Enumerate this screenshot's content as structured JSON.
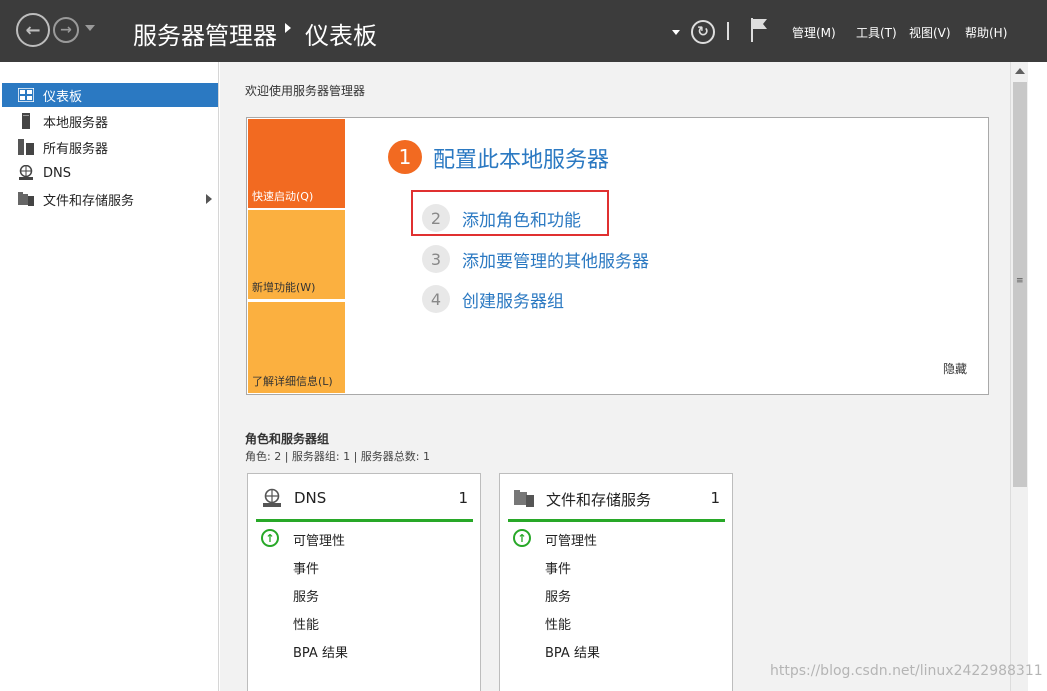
{
  "titlebar": {
    "app_title": "服务器管理器",
    "page_title": "仪表板",
    "menu": [
      "管理(M)",
      "工具(T)",
      "视图(V)",
      "帮助(H)"
    ]
  },
  "sidebar": {
    "items": [
      {
        "label": "仪表板",
        "icon": "dashboard-icon",
        "active": true
      },
      {
        "label": "本地服务器",
        "icon": "server-icon"
      },
      {
        "label": "所有服务器",
        "icon": "servers-icon"
      },
      {
        "label": "DNS",
        "icon": "dns-icon"
      },
      {
        "label": "文件和存储服务",
        "icon": "folder-storage-icon",
        "expandable": true
      }
    ]
  },
  "main": {
    "welcome_title": "欢迎使用服务器管理器",
    "quick_start": {
      "tiles": [
        "快速启动(Q)",
        "新增功能(W)",
        "了解详细信息(L)"
      ],
      "step1": {
        "num": "1",
        "label": "配置此本地服务器"
      },
      "steps": [
        {
          "num": "2",
          "label": "添加角色和功能"
        },
        {
          "num": "3",
          "label": "添加要管理的其他服务器"
        },
        {
          "num": "4",
          "label": "创建服务器组"
        }
      ],
      "hide_label": "隐藏"
    },
    "roles": {
      "title": "角色和服务器组",
      "summary": "角色: 2 | 服务器组: 1 | 服务器总数: 1",
      "cards": [
        {
          "name": "DNS",
          "count": "1",
          "rows": [
            "可管理性",
            "事件",
            "服务",
            "性能",
            "BPA 结果"
          ]
        },
        {
          "name": "文件和存储服务",
          "count": "1",
          "rows": [
            "可管理性",
            "事件",
            "服务",
            "性能",
            "BPA 结果"
          ]
        }
      ]
    }
  },
  "watermark": "https://blog.csdn.net/linux2422988311",
  "colors": {
    "accent": "#2b79c2",
    "orange": "#f26a21",
    "amber": "#fbb040",
    "status_ok": "#28a828",
    "highlight": "#e03030"
  }
}
